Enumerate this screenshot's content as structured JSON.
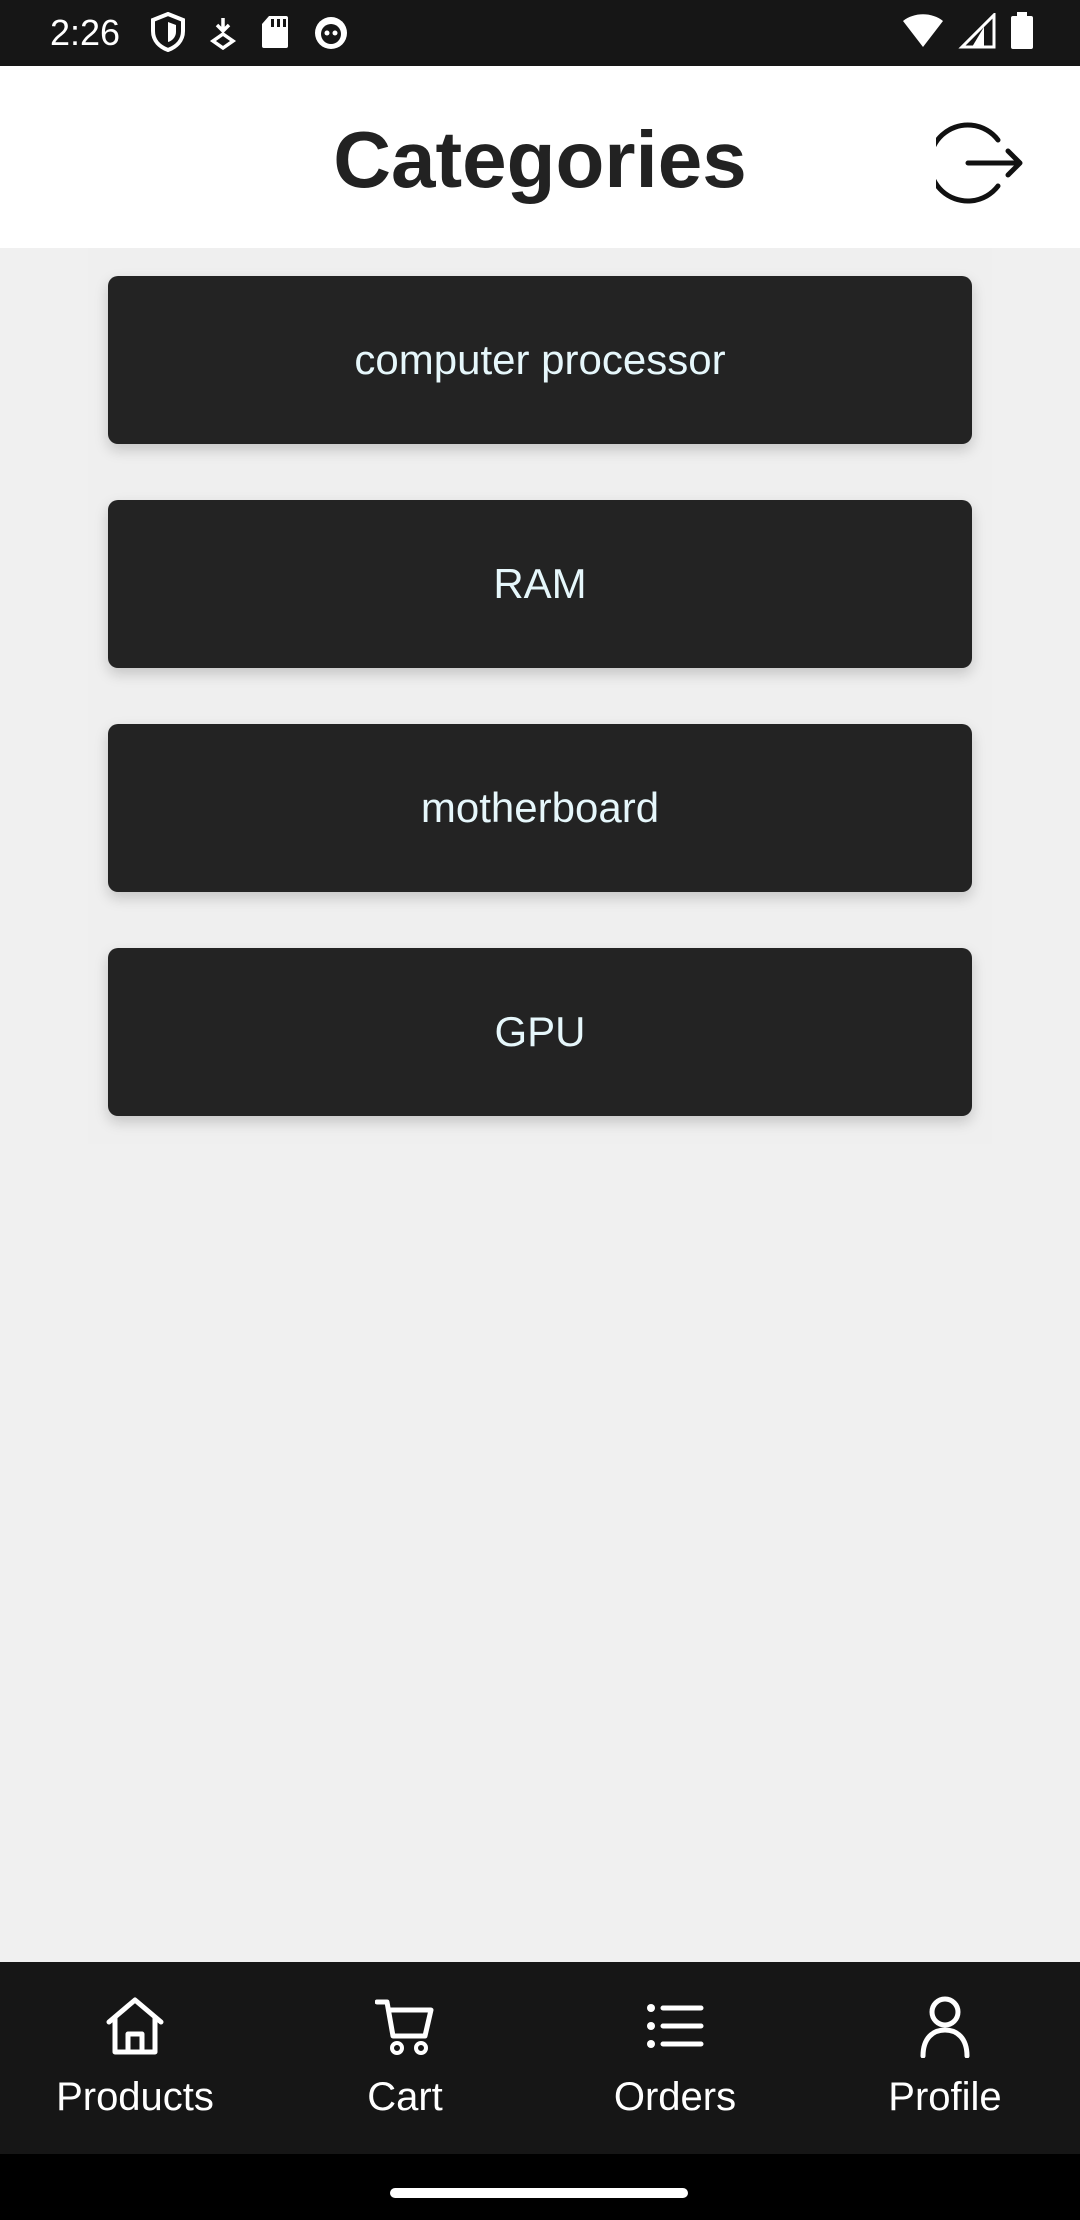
{
  "status_bar": {
    "time": "2:26",
    "icons_left": [
      "shield-icon",
      "download-icon",
      "sd-card-icon",
      "cat-icon"
    ],
    "icons_right": [
      "wifi-icon",
      "signal-icon",
      "battery-icon"
    ]
  },
  "header": {
    "title": "Categories",
    "logout_icon": "logout-icon"
  },
  "categories": [
    {
      "label": "computer processor"
    },
    {
      "label": "RAM"
    },
    {
      "label": "motherboard"
    },
    {
      "label": "GPU"
    }
  ],
  "bottom_nav": {
    "items": [
      {
        "label": "Products",
        "icon": "home-icon"
      },
      {
        "label": "Cart",
        "icon": "cart-icon"
      },
      {
        "label": "Orders",
        "icon": "list-icon"
      },
      {
        "label": "Profile",
        "icon": "person-icon"
      }
    ]
  },
  "colors": {
    "status_bar_bg": "#161616",
    "header_bg": "#ffffff",
    "card_bg": "#232323",
    "card_text": "#e6f7fb",
    "page_bg": "#f0f0f0",
    "nav_bg": "#161616"
  }
}
